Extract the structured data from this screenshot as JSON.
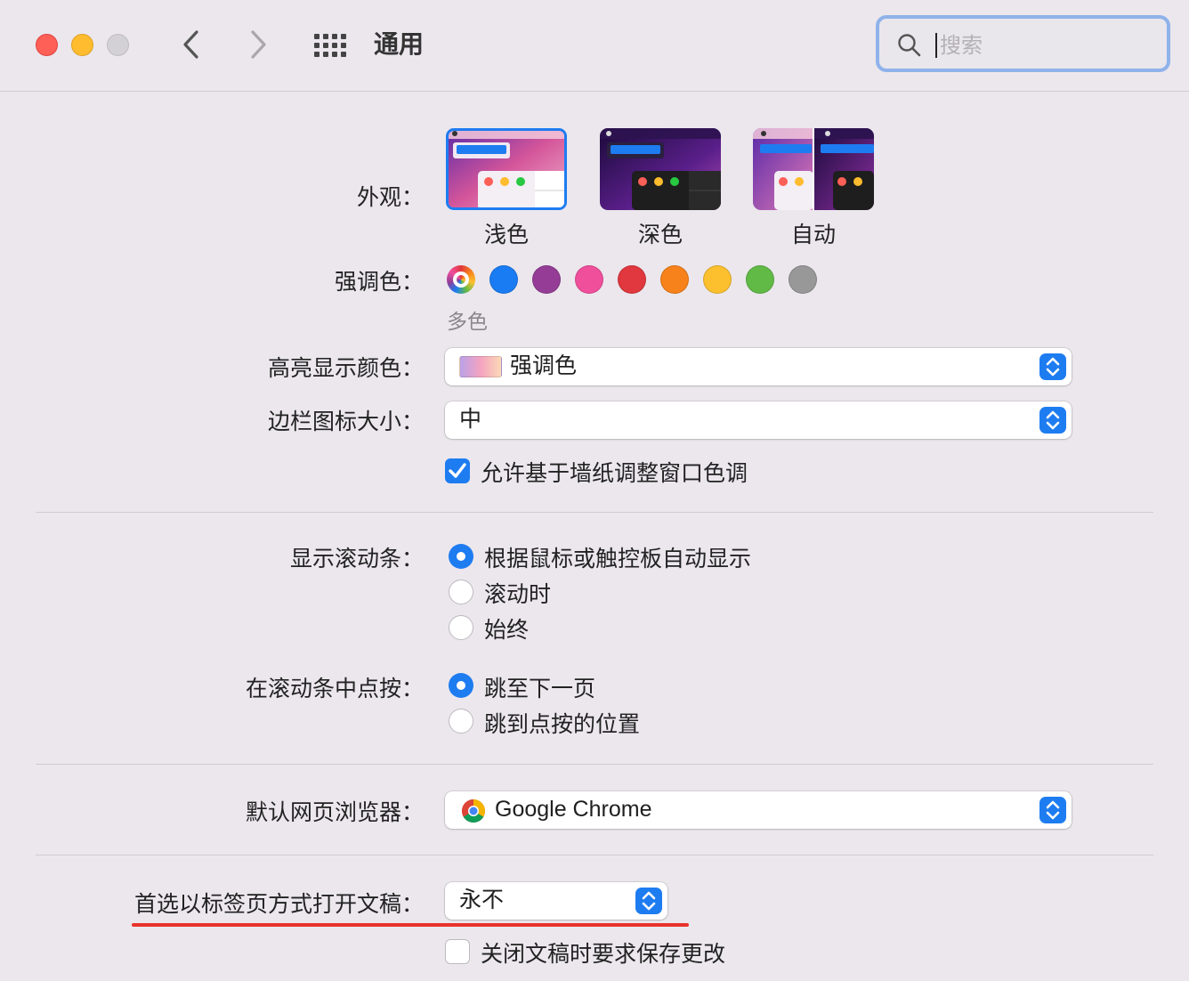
{
  "window": {
    "title": "通用"
  },
  "search": {
    "placeholder": "搜索"
  },
  "appearance": {
    "label": "外观：",
    "options": [
      {
        "name": "浅色",
        "selected": true
      },
      {
        "name": "深色",
        "selected": false
      },
      {
        "name": "自动",
        "selected": false
      }
    ]
  },
  "accent": {
    "label": "强调色：",
    "selected_name": "多色",
    "colors": [
      "multicolor",
      "#1a7cf3",
      "#953d96",
      "#f04f9c",
      "#e0383e",
      "#f7821b",
      "#fcc02f",
      "#62ba46",
      "#989898"
    ]
  },
  "highlight": {
    "label": "高亮显示颜色：",
    "value": "强调色"
  },
  "sidebar_icon": {
    "label": "边栏图标大小：",
    "value": "中"
  },
  "wallpaper_tint": {
    "label": "允许基于墙纸调整窗口色调",
    "checked": true
  },
  "scrollbars": {
    "label": "显示滚动条：",
    "options": [
      "根据鼠标或触控板自动显示",
      "滚动时",
      "始终"
    ],
    "selected": 0
  },
  "click_scrollbar": {
    "label": "在滚动条中点按：",
    "options": [
      "跳至下一页",
      "跳到点按的位置"
    ],
    "selected": 0
  },
  "browser": {
    "label": "默认网页浏览器：",
    "value": "Google Chrome"
  },
  "tabs": {
    "label": "首选以标签页方式打开文稿：",
    "value": "永不"
  },
  "ask_save": {
    "label": "关闭文稿时要求保存更改",
    "checked": false
  },
  "colors": {
    "accent": "#1e7cf1",
    "annotation": "#e8322a",
    "background": "#ebe7ed"
  }
}
